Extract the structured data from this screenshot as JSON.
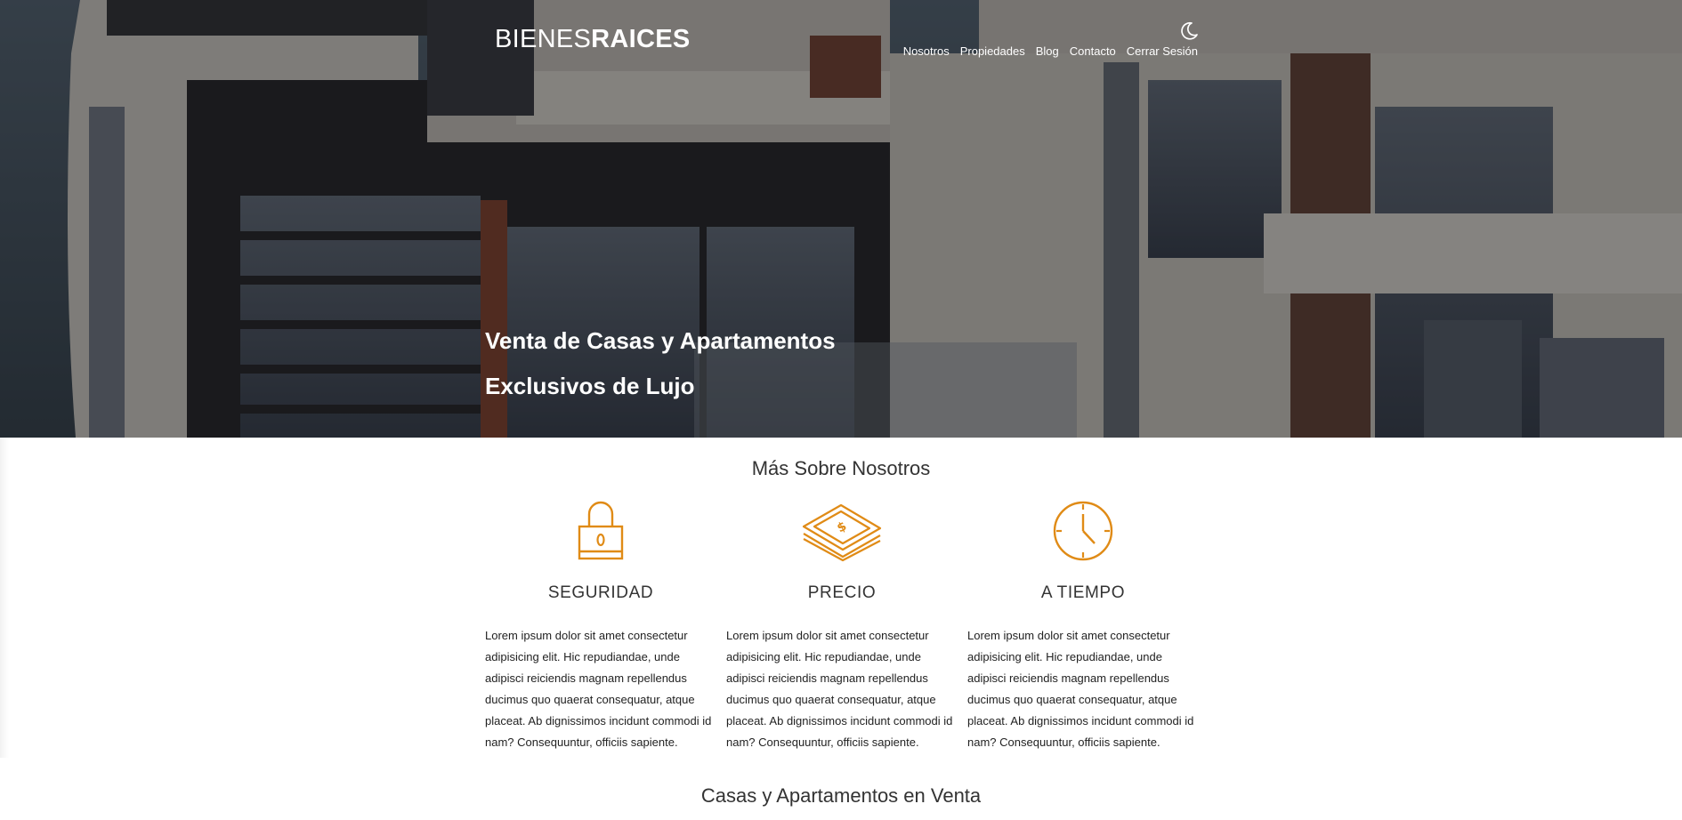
{
  "header": {
    "logo_light": "BIENES",
    "logo_bold": "RAICES",
    "theme_toggle_icon": "moon-icon",
    "nav": [
      {
        "label": "Nosotros"
      },
      {
        "label": "Propiedades"
      },
      {
        "label": "Blog"
      },
      {
        "label": "Contacto"
      },
      {
        "label": "Cerrar Sesión"
      }
    ]
  },
  "hero": {
    "heading_line1": "Venta de Casas y Apartamentos",
    "heading_line2": "Exclusivos de Lujo"
  },
  "about": {
    "title": "Más Sobre Nosotros",
    "features": [
      {
        "icon": "padlock-icon",
        "title": "SEGURIDAD",
        "text": "Lorem ipsum dolor sit amet consectetur adipisicing elit. Hic repudiandae, unde adipisci reiciendis magnam repellendus ducimus quo quaerat consequatur, atque placeat. Ab dignissimos incidunt commodi id nam? Consequuntur, officiis sapiente."
      },
      {
        "icon": "money-stack-icon",
        "title": "PRECIO",
        "text": "Lorem ipsum dolor sit amet consectetur adipisicing elit. Hic repudiandae, unde adipisci reiciendis magnam repellendus ducimus quo quaerat consequatur, atque placeat. Ab dignissimos incidunt commodi id nam? Consequuntur, officiis sapiente."
      },
      {
        "icon": "clock-icon",
        "title": "A TIEMPO",
        "text": "Lorem ipsum dolor sit amet consectetur adipisicing elit. Hic repudiandae, unde adipisci reiciendis magnam repellendus ducimus quo quaerat consequatur, atque placeat. Ab dignissimos incidunt commodi id nam? Consequuntur, officiis sapiente."
      }
    ]
  },
  "sale": {
    "title": "Casas y Apartamentos en Venta"
  },
  "colors": {
    "accent": "#e08b16",
    "text_dark": "#333333",
    "nav_text": "#ffffff"
  }
}
